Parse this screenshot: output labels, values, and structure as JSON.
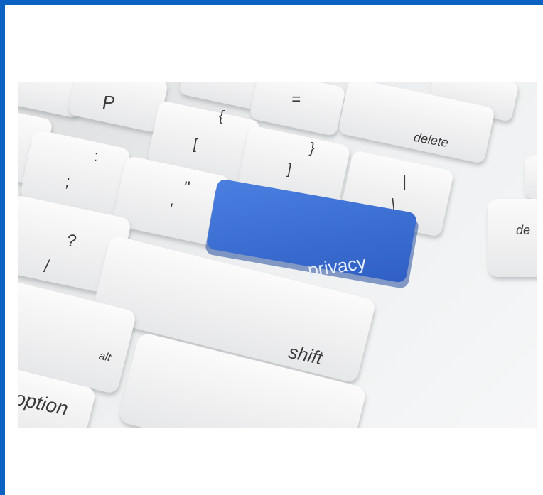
{
  "image": {
    "subject": "keyboard-with-privacy-key",
    "keys": {
      "privacy": "privacy",
      "shift": "shift",
      "delete": "delete",
      "delete_partial": "de",
      "alt": "alt",
      "option": "option",
      "p": "P",
      "brace_open": "{",
      "bracket_open": "[",
      "brace_close": "}",
      "bracket_close": "]",
      "equals": "=",
      "colon": ":",
      "semicolon": ";",
      "quote": "\"",
      "apostrophe": "'",
      "question": "?",
      "slash": "/",
      "pipe": "|",
      "backslash": "\\"
    },
    "colors": {
      "frame": "#0a63c2",
      "privacy_key": "#3b6fd6",
      "keys": "#f2f3f4",
      "key_text": "#3b3b3b"
    }
  }
}
